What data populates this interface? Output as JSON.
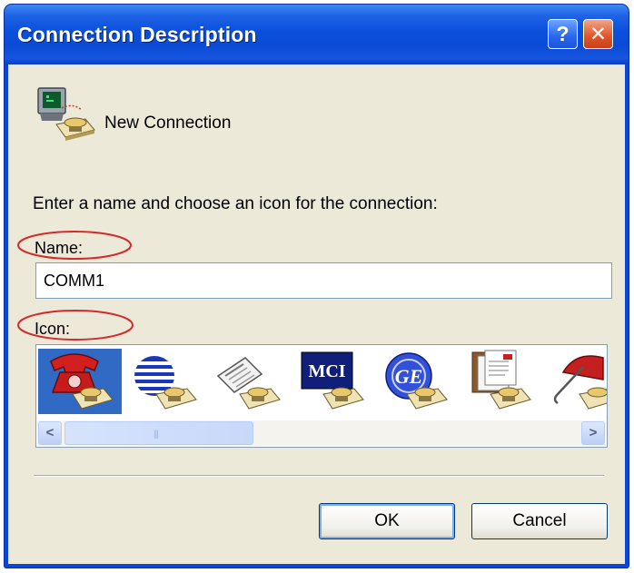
{
  "window": {
    "title": "Connection Description",
    "help_button": "?",
    "close_button": "✕"
  },
  "connection": {
    "name": "New Connection",
    "icon": "phone-computer-icon"
  },
  "instruction": "Enter a name and choose an icon for the connection:",
  "name_field": {
    "label": "Name:",
    "value": "COMM1"
  },
  "icon_field": {
    "label": "Icon:",
    "items": [
      {
        "icon": "red-telephone-icon",
        "selected": true
      },
      {
        "icon": "globe-icon",
        "selected": false
      },
      {
        "icon": "newspaper-icon",
        "selected": false
      },
      {
        "icon": "mci-logo-icon",
        "label": "MCI",
        "selected": false
      },
      {
        "icon": "ge-logo-icon",
        "label": "GE",
        "selected": false
      },
      {
        "icon": "documents-icon",
        "selected": false
      },
      {
        "icon": "umbrella-icon",
        "selected": false
      }
    ]
  },
  "scrollbar": {
    "left_arrow": "<",
    "right_arrow": ">",
    "grip": "|||"
  },
  "buttons": {
    "ok": "OK",
    "cancel": "Cancel"
  },
  "colors": {
    "titlebar": "#0a4fdb",
    "dialog_bg": "#ece9d8",
    "selection": "#316ac5",
    "annotation": "#d32b2b"
  }
}
